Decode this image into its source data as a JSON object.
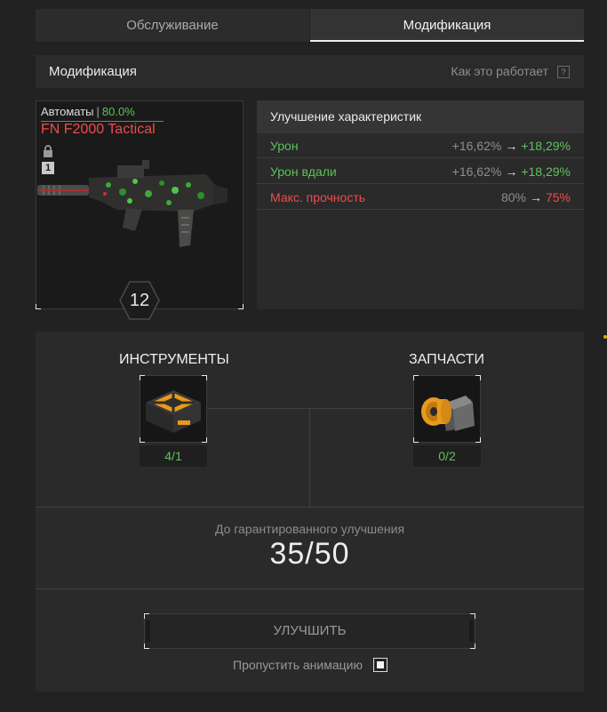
{
  "tabs": [
    {
      "label": "Обслуживание",
      "active": false
    },
    {
      "label": "Модификация",
      "active": true
    }
  ],
  "section": {
    "title": "Модификация",
    "how_it_works": "Как это работает",
    "help_symbol": "?"
  },
  "weapon": {
    "category": "Автоматы",
    "category_percent": "80.0%",
    "name": "FN F2000 Tactical",
    "rank_badge": "1",
    "level": "12",
    "icons": [
      "lock-icon",
      "weapon-image"
    ]
  },
  "stats": {
    "title": "Улучшение характеристик",
    "rows": [
      {
        "name": "Урон",
        "from": "+16,62%",
        "to": "+18,29%",
        "arrow": "→",
        "tone": "positive"
      },
      {
        "name": "Урон вдали",
        "from": "+16,62%",
        "to": "+18,29%",
        "arrow": "→",
        "tone": "positive"
      },
      {
        "name": "Макс. прочность",
        "from": "80%",
        "to": "75%",
        "arrow": "→",
        "tone": "negative"
      }
    ]
  },
  "resources": {
    "tools": {
      "label": "ИНСТРУМЕНТЫ",
      "count": "4/1",
      "icon": "toolbox-icon"
    },
    "parts": {
      "label": "ЗАПЧАСТИ",
      "count": "0/2",
      "icon": "spare-parts-icon"
    }
  },
  "guarantee": {
    "label": "До гарантированного улучшения",
    "value": "35/50"
  },
  "actions": {
    "upgrade_label": "УЛУЧШИТЬ",
    "skip_animation_label": "Пропустить анимацию",
    "skip_animation_checked": true
  },
  "colors": {
    "positive": "#5fc25a",
    "negative": "#ef4b4b",
    "accent_orange": "#e89a1c"
  }
}
